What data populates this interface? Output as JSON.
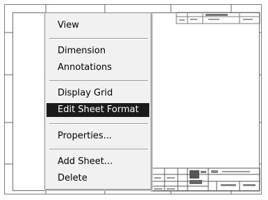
{
  "menu": {
    "items": [
      {
        "label": "View"
      },
      {
        "label": "Dimension"
      },
      {
        "label": "Annotations"
      },
      {
        "label": "Display Grid"
      },
      {
        "label": "Edit Sheet Format"
      },
      {
        "label": "Properties..."
      },
      {
        "label": "Add Sheet..."
      },
      {
        "label": "Delete"
      }
    ],
    "highlighted": "Edit Sheet Format"
  },
  "colors": {
    "menu_background": "#f1f1f1",
    "highlight_background": "#1b1b1b",
    "highlight_text": "#ffffff",
    "frame_line": "#6d6d6d"
  }
}
